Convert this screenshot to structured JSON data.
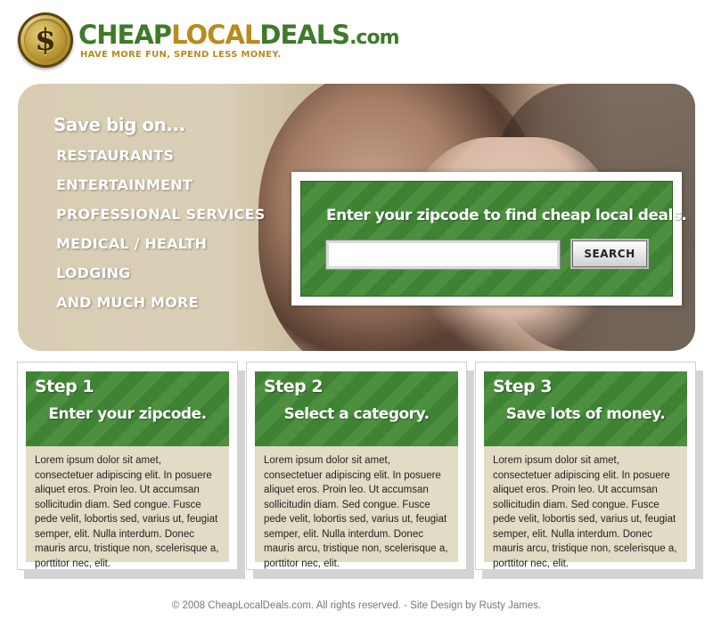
{
  "logo": {
    "symbol": "$",
    "brand_part1": "CHEAP",
    "brand_part2": "LOCAL",
    "brand_part3": "DEALS",
    "brand_part4": ".com",
    "tagline": "HAVE MORE FUN, SPEND LESS MONEY."
  },
  "hero": {
    "heading": "Save big on...",
    "categories": [
      "RESTAURANTS",
      "ENTERTAINMENT",
      "PROFESSIONAL SERVICES",
      "MEDICAL / HEALTH",
      "LODGING",
      "AND MUCH MORE"
    ]
  },
  "search": {
    "title": "Enter your zipcode to find cheap local deals.",
    "zip_value": "",
    "button_label": "SEARCH"
  },
  "steps": [
    {
      "number": "Step 1",
      "subtitle": "Enter your zipcode.",
      "body": "Lorem ipsum dolor sit amet, consectetuer adipiscing elit. In posuere aliquet eros. Proin leo. Ut accumsan sollicitudin diam. Sed congue. Fusce pede velit, lobortis sed, varius ut, feugiat semper, elit. Nulla interdum. Donec mauris arcu, tristique non, scelerisque a, porttitor nec, elit."
    },
    {
      "number": "Step 2",
      "subtitle": "Select a category.",
      "body": "Lorem ipsum dolor sit amet, consectetuer adipiscing elit. In posuere aliquet eros. Proin leo. Ut accumsan sollicitudin diam. Sed congue. Fusce pede velit, lobortis sed, varius ut, feugiat semper, elit. Nulla interdum. Donec mauris arcu, tristique non, scelerisque a, porttitor nec, elit."
    },
    {
      "number": "Step 3",
      "subtitle": "Save lots of money.",
      "body": "Lorem ipsum dolor sit amet, consectetuer adipiscing elit. In posuere aliquet eros. Proin leo. Ut accumsan sollicitudin diam. Sed congue. Fusce pede velit, lobortis sed, varius ut, feugiat semper, elit. Nulla interdum. Donec mauris arcu, tristique non, scelerisque a, porttitor nec, elit."
    }
  ],
  "footer": {
    "text": "© 2008 CheapLocalDeals.com. All rights reserved. - Site Design by Rusty James."
  },
  "colors": {
    "brand_green": "#3e7a2a",
    "brand_gold": "#b98b1e",
    "panel_green": "#3f8234",
    "step_body_bg": "#e2dbc5"
  }
}
